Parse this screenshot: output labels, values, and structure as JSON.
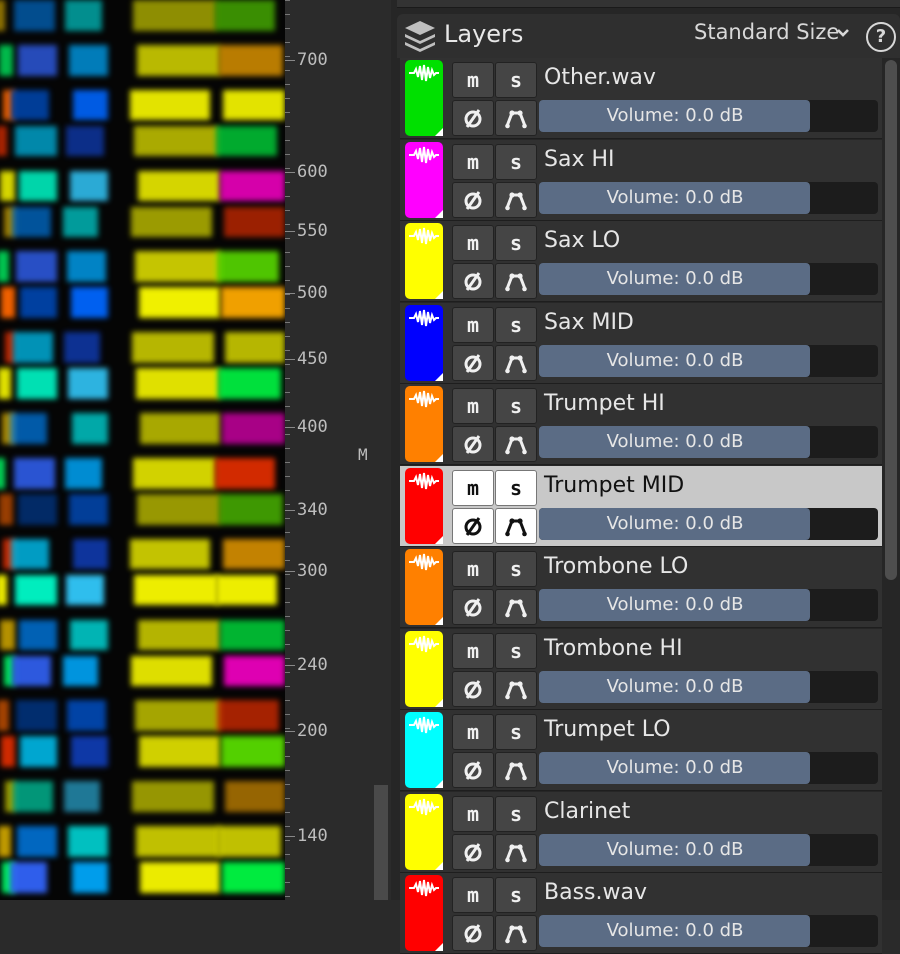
{
  "colors": {
    "accent_volume": "#5b6c85",
    "selected_row": "#c8c8c8",
    "panel_bg": "#262626"
  },
  "ruler": {
    "labels": [
      "700",
      "600",
      "550",
      "500",
      "450",
      "400",
      "340",
      "300",
      "240",
      "200",
      "140"
    ],
    "mark": "M"
  },
  "panel": {
    "title": "Layers",
    "size_option": "Standard Size",
    "icons": {
      "layers": "layers-stack-icon",
      "chevron": "chevron-down-icon",
      "help": "help-icon"
    }
  },
  "layers": [
    {
      "name": "Other.wav",
      "color": "#00e000",
      "mute": "m",
      "solo": "s",
      "volume": "Volume: 0.0 dB",
      "volume_level": 0.8,
      "selected": false
    },
    {
      "name": "Sax HI",
      "color": "#ff00ff",
      "mute": "m",
      "solo": "s",
      "volume": "Volume: 0.0 dB",
      "volume_level": 0.8,
      "selected": false
    },
    {
      "name": "Sax LO",
      "color": "#ffff00",
      "mute": "m",
      "solo": "s",
      "volume": "Volume: 0.0 dB",
      "volume_level": 0.8,
      "selected": false
    },
    {
      "name": "Sax MID",
      "color": "#0000ff",
      "mute": "m",
      "solo": "s",
      "volume": "Volume: 0.0 dB",
      "volume_level": 0.8,
      "selected": false
    },
    {
      "name": "Trumpet HI",
      "color": "#ff8000",
      "mute": "m",
      "solo": "s",
      "volume": "Volume: 0.0 dB",
      "volume_level": 0.8,
      "selected": false
    },
    {
      "name": "Trumpet MID",
      "color": "#ff0000",
      "mute": "m",
      "solo": "s",
      "volume": "Volume: 0.0 dB",
      "volume_level": 0.8,
      "selected": true
    },
    {
      "name": "Trombone LO",
      "color": "#ff8000",
      "mute": "m",
      "solo": "s",
      "volume": "Volume: 0.0 dB",
      "volume_level": 0.8,
      "selected": false
    },
    {
      "name": "Trombone HI",
      "color": "#ffff00",
      "mute": "m",
      "solo": "s",
      "volume": "Volume: 0.0 dB",
      "volume_level": 0.8,
      "selected": false
    },
    {
      "name": "Trumpet LO",
      "color": "#00ffff",
      "mute": "m",
      "solo": "s",
      "volume": "Volume: 0.0 dB",
      "volume_level": 0.8,
      "selected": false
    },
    {
      "name": "Clarinet",
      "color": "#ffff00",
      "mute": "m",
      "solo": "s",
      "volume": "Volume: 0.0 dB",
      "volume_level": 0.8,
      "selected": false
    },
    {
      "name": "Bass.wav",
      "color": "#ff0000",
      "mute": "m",
      "solo": "s",
      "volume": "Volume: 0.0 dB",
      "volume_level": 0.8,
      "selected": false
    }
  ]
}
